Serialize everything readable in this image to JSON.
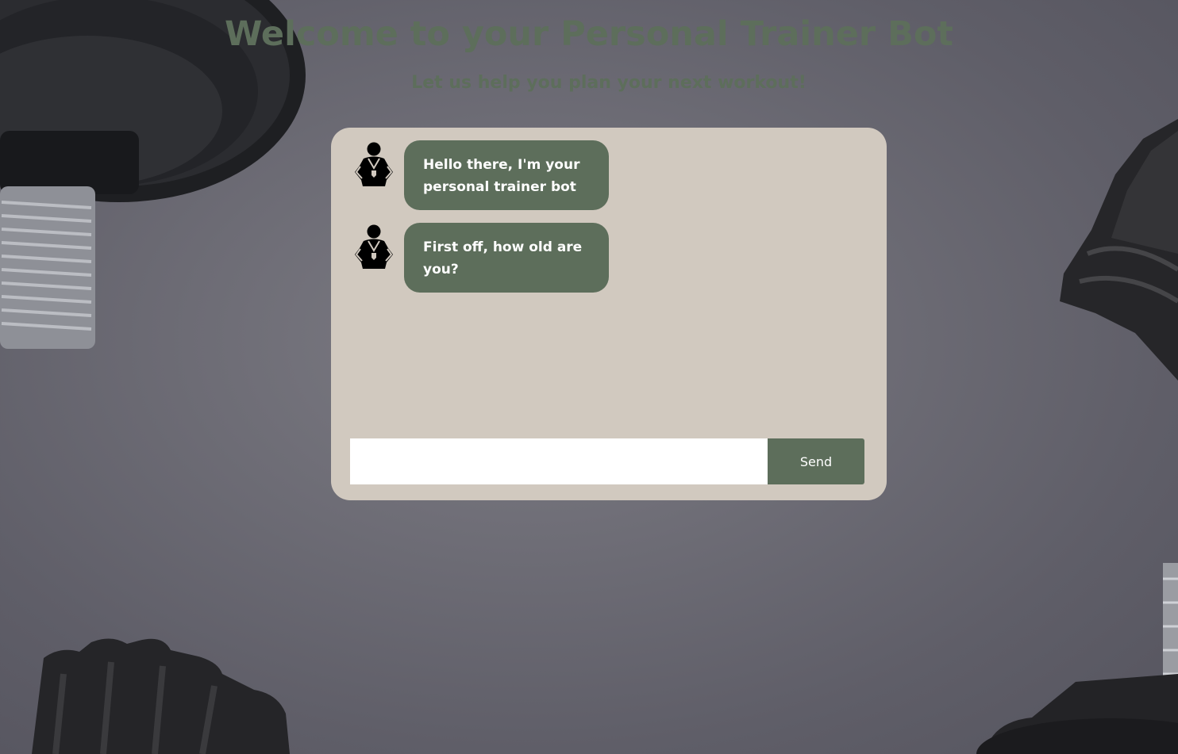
{
  "header": {
    "title": "Welcome to your Personal Trainer Bot",
    "subtitle": "Let us help you plan your next workout!"
  },
  "chat": {
    "messages": [
      {
        "sender": "bot",
        "avatar_icon": "trainer-bot-icon",
        "text": "Hello there, I'm your personal trainer bot"
      },
      {
        "sender": "bot",
        "avatar_icon": "trainer-bot-icon",
        "text": "First off, how old are you?"
      }
    ],
    "input": {
      "value": "",
      "placeholder": ""
    },
    "send_label": "Send"
  },
  "colors": {
    "accent": "#5d6e5b",
    "panel": "#d1c9bf",
    "background": "#6e6d76",
    "bubble_text": "#ffffff"
  }
}
